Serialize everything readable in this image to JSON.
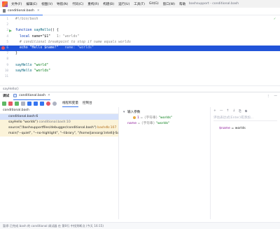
{
  "titlebar": {
    "menu": [
      "文件(F)",
      "编辑(E)",
      "视图(V)",
      "导航(N)",
      "代码(C)",
      "重构(R)",
      "构建(B)",
      "运行(U)",
      "工具(T)",
      "Git(G)",
      "窗口(W)",
      "帮助"
    ],
    "window_title": "bashsupport - conditional.bash"
  },
  "editor_tab": {
    "label": "conditional.bash"
  },
  "editor": {
    "lines": [
      {
        "n": "1",
        "kind": "shebang",
        "text": "#!/bin/bash"
      },
      {
        "n": "2",
        "kind": "empty",
        "text": ""
      },
      {
        "n": "3",
        "kind": "fn_decl",
        "kw": "function",
        "name": "sayHello",
        "rest": "() {"
      },
      {
        "n": "4",
        "kind": "local",
        "kw": "local",
        "rest": "name=\"$1\"",
        "hint": "1: \"worlds\""
      },
      {
        "n": "5",
        "kind": "comment",
        "text": "# conditional breakpoint to stop if name equals worlds"
      },
      {
        "n": "6",
        "kind": "echo",
        "text": "echo \"Hello $name!\"",
        "hint": "name: \"worlds\""
      },
      {
        "n": "7",
        "kind": "plain",
        "text": "}"
      },
      {
        "n": "8",
        "kind": "empty",
        "text": ""
      },
      {
        "n": "9",
        "kind": "call",
        "name": "sayHello",
        "arg": "\"world\""
      },
      {
        "n": "10",
        "kind": "call",
        "name": "sayHello",
        "arg": "\"worlds\""
      },
      {
        "n": "11",
        "kind": "empty",
        "text": ""
      }
    ]
  },
  "breadcrumb": {
    "text": "sayHello()"
  },
  "debug": {
    "title": "调试",
    "session_label": "conditional.bash",
    "tabs": [
      "线程和变量",
      "控制台"
    ],
    "thread": "conditional.bash",
    "frames": [
      {
        "name": "conditional.bash:6",
        "loc": "",
        "style": "sel"
      },
      {
        "name": "sayHello \"worlds\")",
        "loc": "conditional.bash:10",
        "style": "yel"
      },
      {
        "name": "source(\"/bashsupportfiles/debugger/conditional.bash\")",
        "loc": "bashdb:107",
        "style": "yel"
      },
      {
        "name": "main(\"--quiet\", \"--no-highlight\", \"--library\", \"/home/jansorg/.IntelliJ-Scrip",
        "loc": "",
        "style": "yel"
      }
    ],
    "variables": [
      {
        "chev": "▾",
        "icon": false,
        "name": "输入参数",
        "type": "",
        "val": "",
        "indent": 0
      },
      {
        "chev": "",
        "icon": true,
        "name": "1",
        "type": " = {字符串} ",
        "val": "\"worlds\"",
        "indent": 1
      },
      {
        "chev": "",
        "icon": false,
        "name": "name",
        "type": " = {字符串} ",
        "val": "\"worlds\"",
        "indent": 0
      }
    ],
    "watches": {
      "toolbar": [
        "+",
        "—",
        "↑",
        "↓",
        "⎘",
        "⧉"
      ],
      "placeholder": "评估表达式(Enter)或添加...",
      "row_name": "$name",
      "row_value": " = worlds"
    }
  },
  "statusbar": {
    "text": "暂停 已完成 bash 的 conditional 调试器 在 第6行 中找到断点 (今天 16:15)"
  },
  "colors": {
    "accent": "#3574f0",
    "exec_line": "#2154d9",
    "breakpoint": "#e55765"
  }
}
